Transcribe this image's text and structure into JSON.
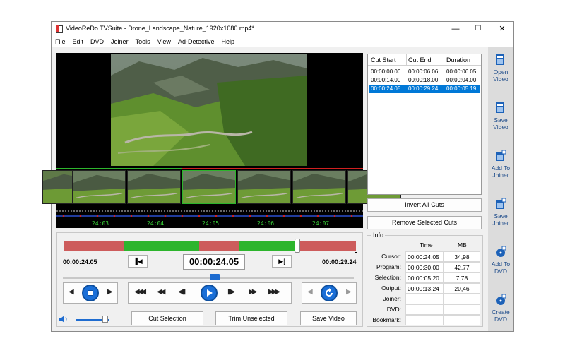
{
  "window": {
    "title": "VideoReDo TVSuite - Drone_Landscape_Nature_1920x1080.mp4*",
    "minimize": "—",
    "maximize": "☐",
    "close": "✕"
  },
  "menu": [
    "File",
    "Edit",
    "DVD",
    "Joiner",
    "Tools",
    "View",
    "Ad-Detective",
    "Help"
  ],
  "timeline": {
    "labels": [
      "24:03",
      "24:04",
      "24:05",
      "24:06",
      "24:07"
    ]
  },
  "controls": {
    "start_time": "00:00:24.05",
    "current_time": "00:00:24.05",
    "end_time": "00:00:29.24",
    "mark_in_icon": "▐◀",
    "mark_out_icon": "▶[",
    "frame_back_icon": "◀",
    "frame_fwd_icon": "▶",
    "rewind_fast": "◀◀◀",
    "rewind": "◀◀",
    "step_back": "◀▮",
    "step_fwd": "▮▶",
    "forward": "▶▶",
    "forward_fast": "▶▶▶",
    "nav_left": "◀",
    "nav_right": "▶"
  },
  "actions": {
    "cut_selection": "Cut Selection",
    "trim_unselected": "Trim Unselected",
    "save_video": "Save Video"
  },
  "cuts": {
    "headers": [
      "Cut Start",
      "Cut End",
      "Duration"
    ],
    "rows": [
      {
        "start": "00:00:00.00",
        "end": "00:00:06.06",
        "duration": "00:00:06.05"
      },
      {
        "start": "00:00:14.00",
        "end": "00:00:18.00",
        "duration": "00:00:04.00"
      },
      {
        "start": "00:00:24.05",
        "end": "00:00:29.24",
        "duration": "00:00:05.19"
      }
    ],
    "invert": "Invert All Cuts",
    "remove": "Remove Selected Cuts"
  },
  "info": {
    "legend": "Info",
    "col_time": "Time",
    "col_mb": "MB",
    "rows": [
      {
        "label": "Cursor:",
        "time": "00:00:24.05",
        "mb": "34,98"
      },
      {
        "label": "Program:",
        "time": "00:00:30.00",
        "mb": "42,77"
      },
      {
        "label": "Selection:",
        "time": "00:00:05.20",
        "mb": "7,78"
      },
      {
        "label": "Output:",
        "time": "00:00:13.24",
        "mb": "20,46"
      },
      {
        "label": "Joiner:",
        "time": "",
        "mb": ""
      },
      {
        "label": "DVD:",
        "time": "",
        "mb": ""
      },
      {
        "label": "Bookmark:",
        "time": "",
        "mb": ""
      }
    ]
  },
  "sidebar": [
    {
      "line1": "Open",
      "line2": "Video",
      "icon": "open-video-icon"
    },
    {
      "line1": "Save",
      "line2": "Video",
      "icon": "save-video-icon"
    },
    {
      "line1": "Add To",
      "line2": "Joiner",
      "icon": "add-joiner-icon"
    },
    {
      "line1": "Save",
      "line2": "Joiner",
      "icon": "save-joiner-icon"
    },
    {
      "line1": "Add To",
      "line2": "DVD",
      "icon": "add-dvd-icon"
    },
    {
      "line1": "Create",
      "line2": "DVD",
      "icon": "create-dvd-icon"
    }
  ],
  "colors": {
    "accent": "#1a6fd8",
    "cut_red": "#cd5c5c",
    "keep_green": "#2db52d",
    "selection": "#0078d7"
  }
}
